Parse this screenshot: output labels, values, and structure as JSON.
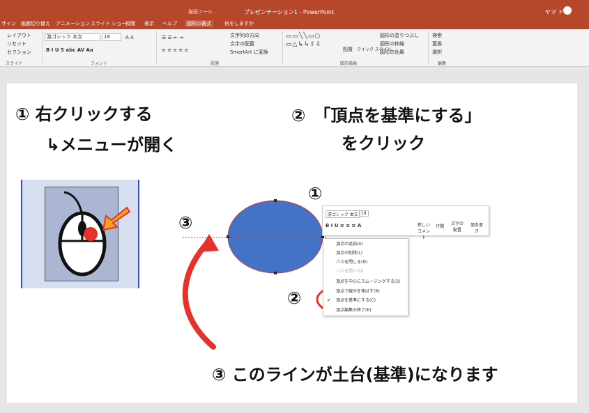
{
  "titlebar": {
    "tool_context": "描画ツール",
    "document_title": "プレゼンテーション1 - PowerPoint",
    "user_name": "ヤマ ドコ"
  },
  "tabs": [
    {
      "label": "ザイン"
    },
    {
      "label": "画面切り替え"
    },
    {
      "label": "アニメーション"
    },
    {
      "label": "スライド ショー"
    },
    {
      "label": "校閲"
    },
    {
      "label": "表示"
    },
    {
      "label": "ヘルプ"
    },
    {
      "label": "図形の書式"
    },
    {
      "label": "何をしますか"
    }
  ],
  "ribbon": {
    "slides_group": {
      "layout": "レイアウト",
      "reset": "リセット",
      "section": "セクション",
      "label": "スライド"
    },
    "font_group": {
      "font_name": "游ゴシック 本文",
      "font_size": "18",
      "label": "フォント"
    },
    "paragraph_group": {
      "text_direction": "文字列の方向",
      "text_align": "文字の配置",
      "smartart": "SmartArt に変換",
      "label": "段落"
    },
    "drawing_group": {
      "arrange": "配置",
      "quick_style": "クイック スタイル",
      "fill": "図形の塗りつぶし",
      "outline": "図形の枠線",
      "effects": "図形の効果",
      "label": "図形描画"
    },
    "editing_group": {
      "find": "検索",
      "replace": "置換",
      "select": "選択",
      "label": "編集"
    }
  },
  "annotations": {
    "step1_line1": "① 右クリックする",
    "step1_line2": "↳メニューが開く",
    "step2_line1": "②　「頂点を基準にする」",
    "step2_line2": "をクリック",
    "step3_bottom": "③ このラインが土台(基準)になります",
    "marker1": "①",
    "marker2": "②",
    "marker3": "③"
  },
  "mini_toolbar": {
    "font_name": "游ゴシック 本文",
    "font_size": "18",
    "new_comment": "新しい コメント",
    "line_spacing": "行間",
    "text_align": "文字の 配置",
    "bullets": "箇条書き"
  },
  "context_menu": {
    "items": [
      {
        "label": "頂点の追加(A)",
        "enabled": true
      },
      {
        "label": "頂点の削除(L)",
        "enabled": true
      },
      {
        "label": "パスを閉じる(N)",
        "enabled": true
      },
      {
        "label": "パスを開く(O)",
        "enabled": false
      },
      {
        "label": "頂点を中心にスムージングする(S)",
        "enabled": true
      },
      {
        "label": "頂点で線分を伸ばす(R)",
        "enabled": true
      },
      {
        "label": "頂点を基準にする(C)",
        "enabled": true,
        "checked": true
      },
      {
        "label": "頂点編集の終了(E)",
        "enabled": true
      }
    ]
  },
  "colors": {
    "accent": "#b7472a",
    "ellipse_fill": "#4472c4",
    "highlight_circle": "#e8312a",
    "arrow": "#e8312a"
  }
}
